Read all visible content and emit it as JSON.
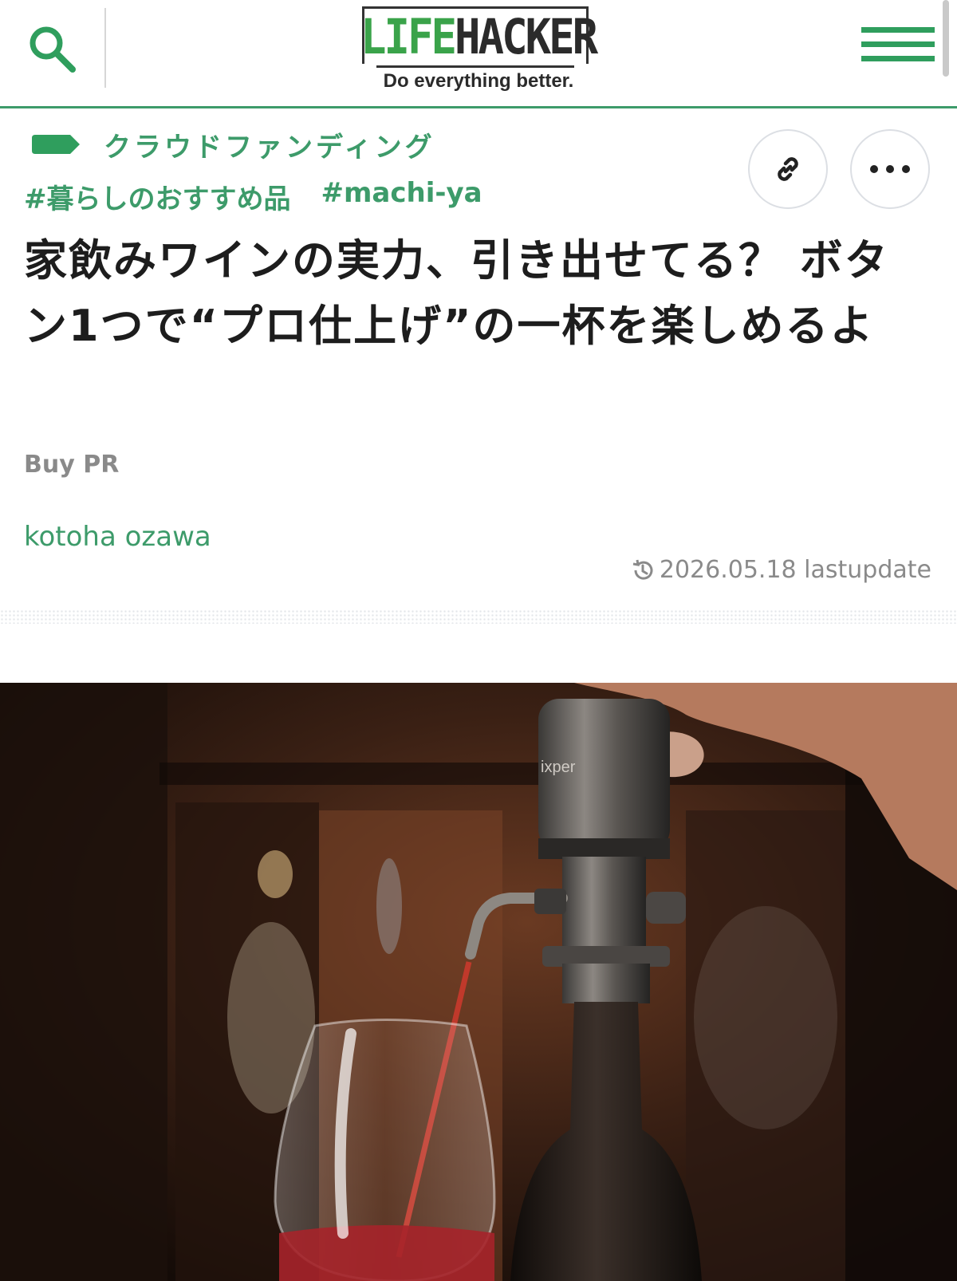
{
  "header": {
    "logo_life": "LIFE",
    "logo_hacker": "HACKER",
    "tagline": "Do everything better.",
    "search_icon": "search-icon",
    "menu_icon": "hamburger-menu-icon",
    "accent_color": "#3d9b6a"
  },
  "category": {
    "label": "クラウドファンディング",
    "icon": "tag-icon"
  },
  "tags": [
    "#暮らしのおすすめ品",
    "#machi-ya"
  ],
  "actions": {
    "link_icon": "link-icon",
    "more_icon": "more-dots-icon"
  },
  "article": {
    "title": "家飲みワインの実力、引き出せてる？ ボタン1つで“プロ仕上げ”の一杯を楽しめるよ",
    "type": "Buy PR",
    "author": "kotoha ozawa",
    "updated": "2026.05.18 lastupdate",
    "history_icon": "history-icon"
  },
  "hero": {
    "brand_text": "ixper"
  }
}
